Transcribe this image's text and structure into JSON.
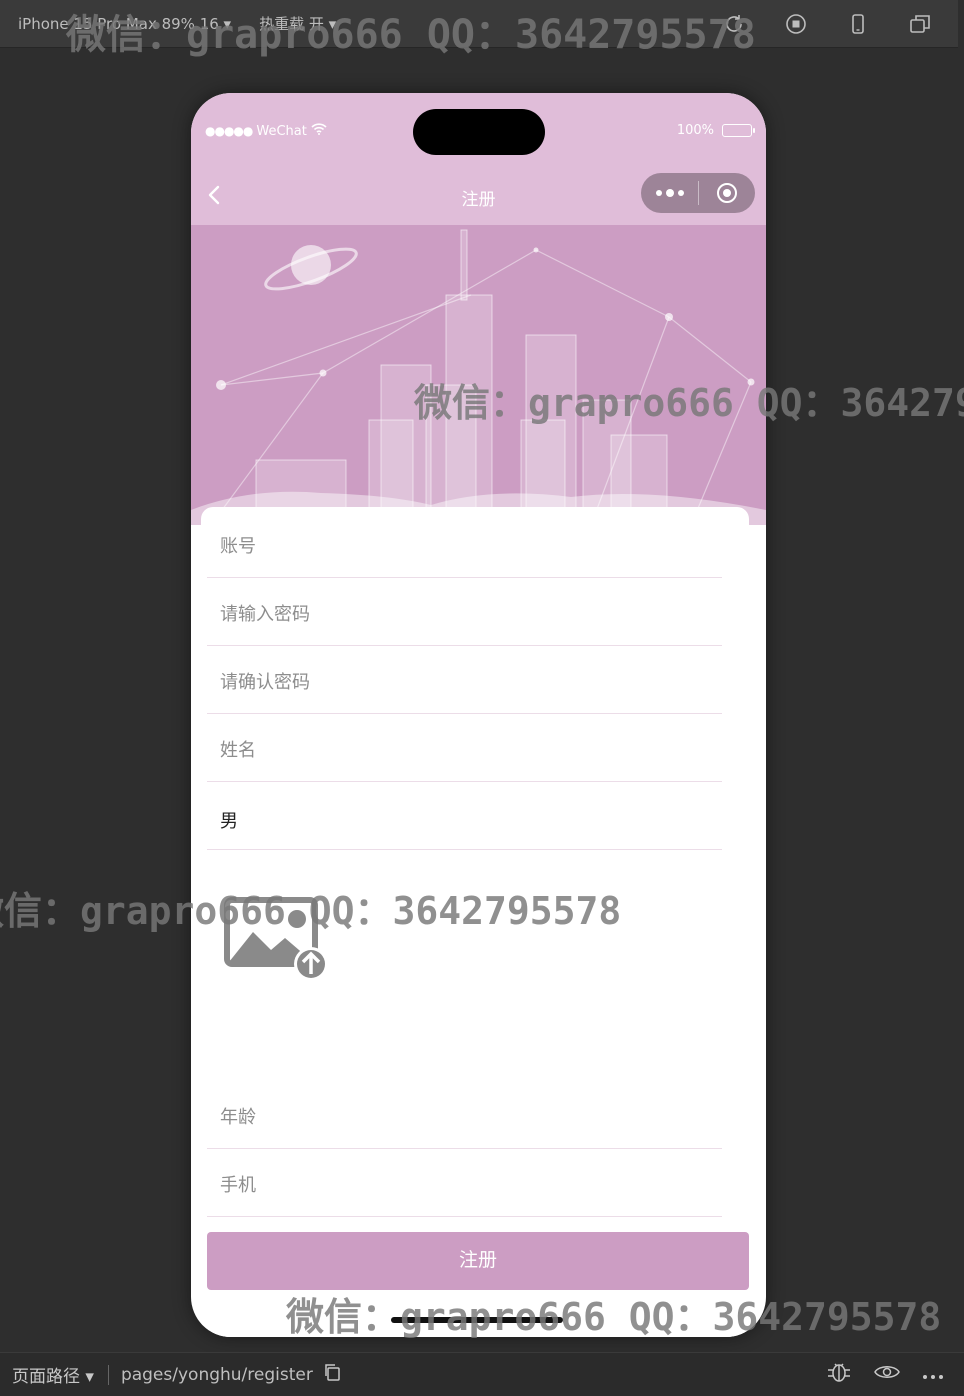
{
  "devbar": {
    "device": "iPhone 15 Pro Max 89% 16 ▾",
    "hot_reload": "热重载 开 ▾",
    "tools": [
      "refresh-icon",
      "stop-icon",
      "phone-icon",
      "window-icon"
    ]
  },
  "statusbar": {
    "signal": "●●●●●",
    "carrier": "WeChat",
    "battery_text": "100%"
  },
  "navbar": {
    "title": "注册"
  },
  "form": {
    "account_placeholder": "账号",
    "password_placeholder": "请输入密码",
    "confirm_password_placeholder": "请确认密码",
    "name_placeholder": "姓名",
    "gender_value": "男",
    "age_placeholder": "年龄",
    "phone_placeholder": "手机",
    "submit_label": "注册"
  },
  "bottombar": {
    "page_path_label": "页面路径 ▾",
    "path": "pages/yonghu/register"
  },
  "watermark": "微信：grapro666 QQ：3642795578",
  "colors": {
    "accent": "#cc9dc3",
    "header": "#e0bdd9",
    "capsule": "#9d8498"
  }
}
